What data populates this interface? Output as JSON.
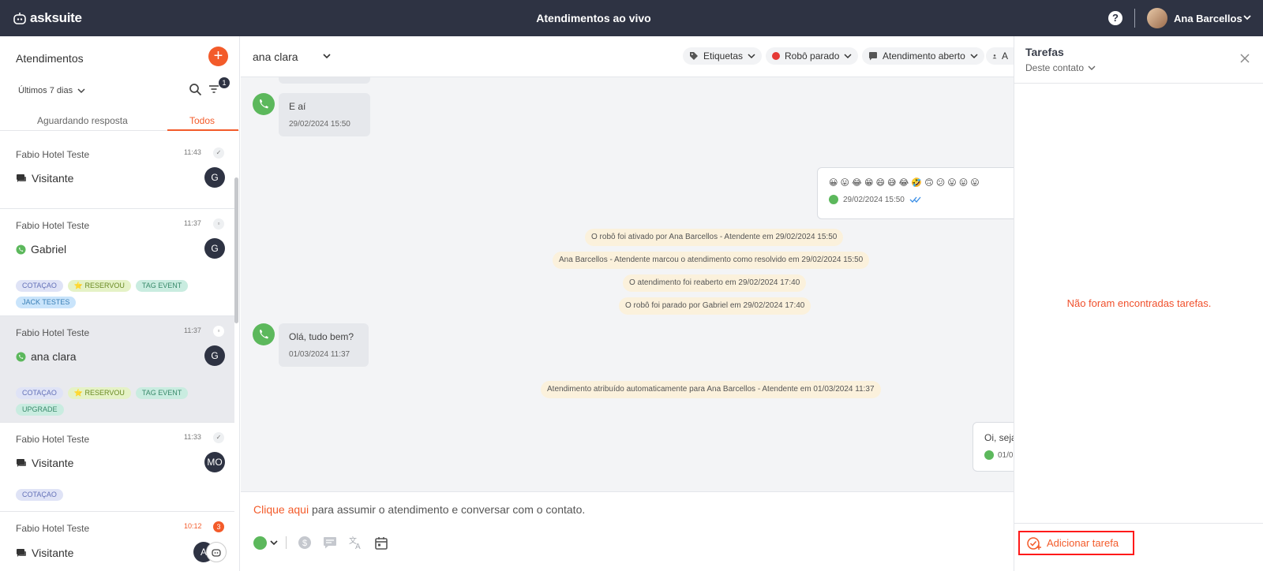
{
  "app": {
    "brand": "asksuite",
    "page_title": "Atendimentos ao vivo",
    "help_label": "?",
    "user_name": "Ana Barcellos"
  },
  "sidebar": {
    "title": "Atendimentos",
    "add_label": "+",
    "period_label": "Últimos 7 dias",
    "filter_count": "1",
    "tabs": {
      "waiting": "Aguardando resposta",
      "all": "Todos"
    },
    "conversations": [
      {
        "company": "Fabio Hotel Teste",
        "time": "11:43",
        "status": "✓",
        "channel": "chat",
        "contact": "Visitante",
        "avatar": "G",
        "tags": []
      },
      {
        "company": "Fabio Hotel Teste",
        "time": "11:37",
        "status": "▫",
        "channel": "whatsapp",
        "contact": "Gabriel",
        "avatar": "G",
        "tags": [
          {
            "label": "COTAÇAO",
            "color": "#dfe3f6",
            "text": "#6471b8"
          },
          {
            "label": "⭐ RESERVOU",
            "color": "#e5f2c6",
            "text": "#6a8a23"
          },
          {
            "label": "TAG EVENT",
            "color": "#c9ece0",
            "text": "#3a8a6b"
          },
          {
            "label": "JACK TESTES",
            "color": "#c9e4fb",
            "text": "#3a7fb6"
          }
        ]
      },
      {
        "company": "Fabio Hotel Teste",
        "time": "11:37",
        "status": "▫",
        "channel": "whatsapp",
        "contact": "ana clara",
        "avatar": "G",
        "selected": true,
        "tags": [
          {
            "label": "COTAÇAO",
            "color": "#dfe3f6",
            "text": "#6471b8"
          },
          {
            "label": "⭐ RESERVOU",
            "color": "#e5f2c6",
            "text": "#6a8a23"
          },
          {
            "label": "TAG EVENT",
            "color": "#c9ece0",
            "text": "#3a8a6b"
          },
          {
            "label": "UPGRADE",
            "color": "#c9ece0",
            "text": "#3a8a6b"
          }
        ]
      },
      {
        "company": "Fabio Hotel Teste",
        "time": "11:33",
        "status": "✓",
        "channel": "chat",
        "contact": "Visitante",
        "avatar": "MO",
        "tags": [
          {
            "label": "COTAÇAO",
            "color": "#dfe3f6",
            "text": "#6471b8"
          }
        ]
      },
      {
        "company": "Fabio Hotel Teste",
        "time": "10:12",
        "count": "3",
        "channel": "chat",
        "contact": "Visitante",
        "avatar": "A",
        "tags": []
      }
    ]
  },
  "chat": {
    "contact_name": "ana clara",
    "header_pills": {
      "tags": "Etiquetas",
      "robot": "Robô parado",
      "status": "Atendimento aberto",
      "agent": "A"
    },
    "messages": {
      "m1_text": "E aí",
      "m1_time": "29/02/2024 15:50",
      "emoji_text": "😀 😛 😂 😁 😄 😅 😂 🤣 🙃 😕 😛 😛 😛",
      "emoji_time": "29/02/2024 15:50",
      "m2_text": "Olá, tudo bem?",
      "m2_time": "01/03/2024 11:37",
      "out2_text": "Oi, seja",
      "out2_time": "01/0"
    },
    "system_notes": [
      "O robô foi ativado por Ana Barcellos - Atendente em 29/02/2024 15:50",
      "Ana Barcellos - Atendente marcou o atendimento como resolvido em 29/02/2024 15:50",
      "O atendimento foi reaberto em 29/02/2024 17:40",
      "O robô foi parado por Gabriel em 29/02/2024 17:40",
      "Atendimento atribuído automaticamente para Ana Barcellos - Atendente em 01/03/2024 11:37"
    ],
    "composer": {
      "link_text": "Clique aqui",
      "rest_text": " para assumir o atendimento e conversar com o contato."
    }
  },
  "tasks": {
    "title": "Tarefas",
    "filter_label": "Deste contato",
    "empty_message": "Não foram encontradas tarefas.",
    "add_label": "Adicionar tarefa"
  }
}
